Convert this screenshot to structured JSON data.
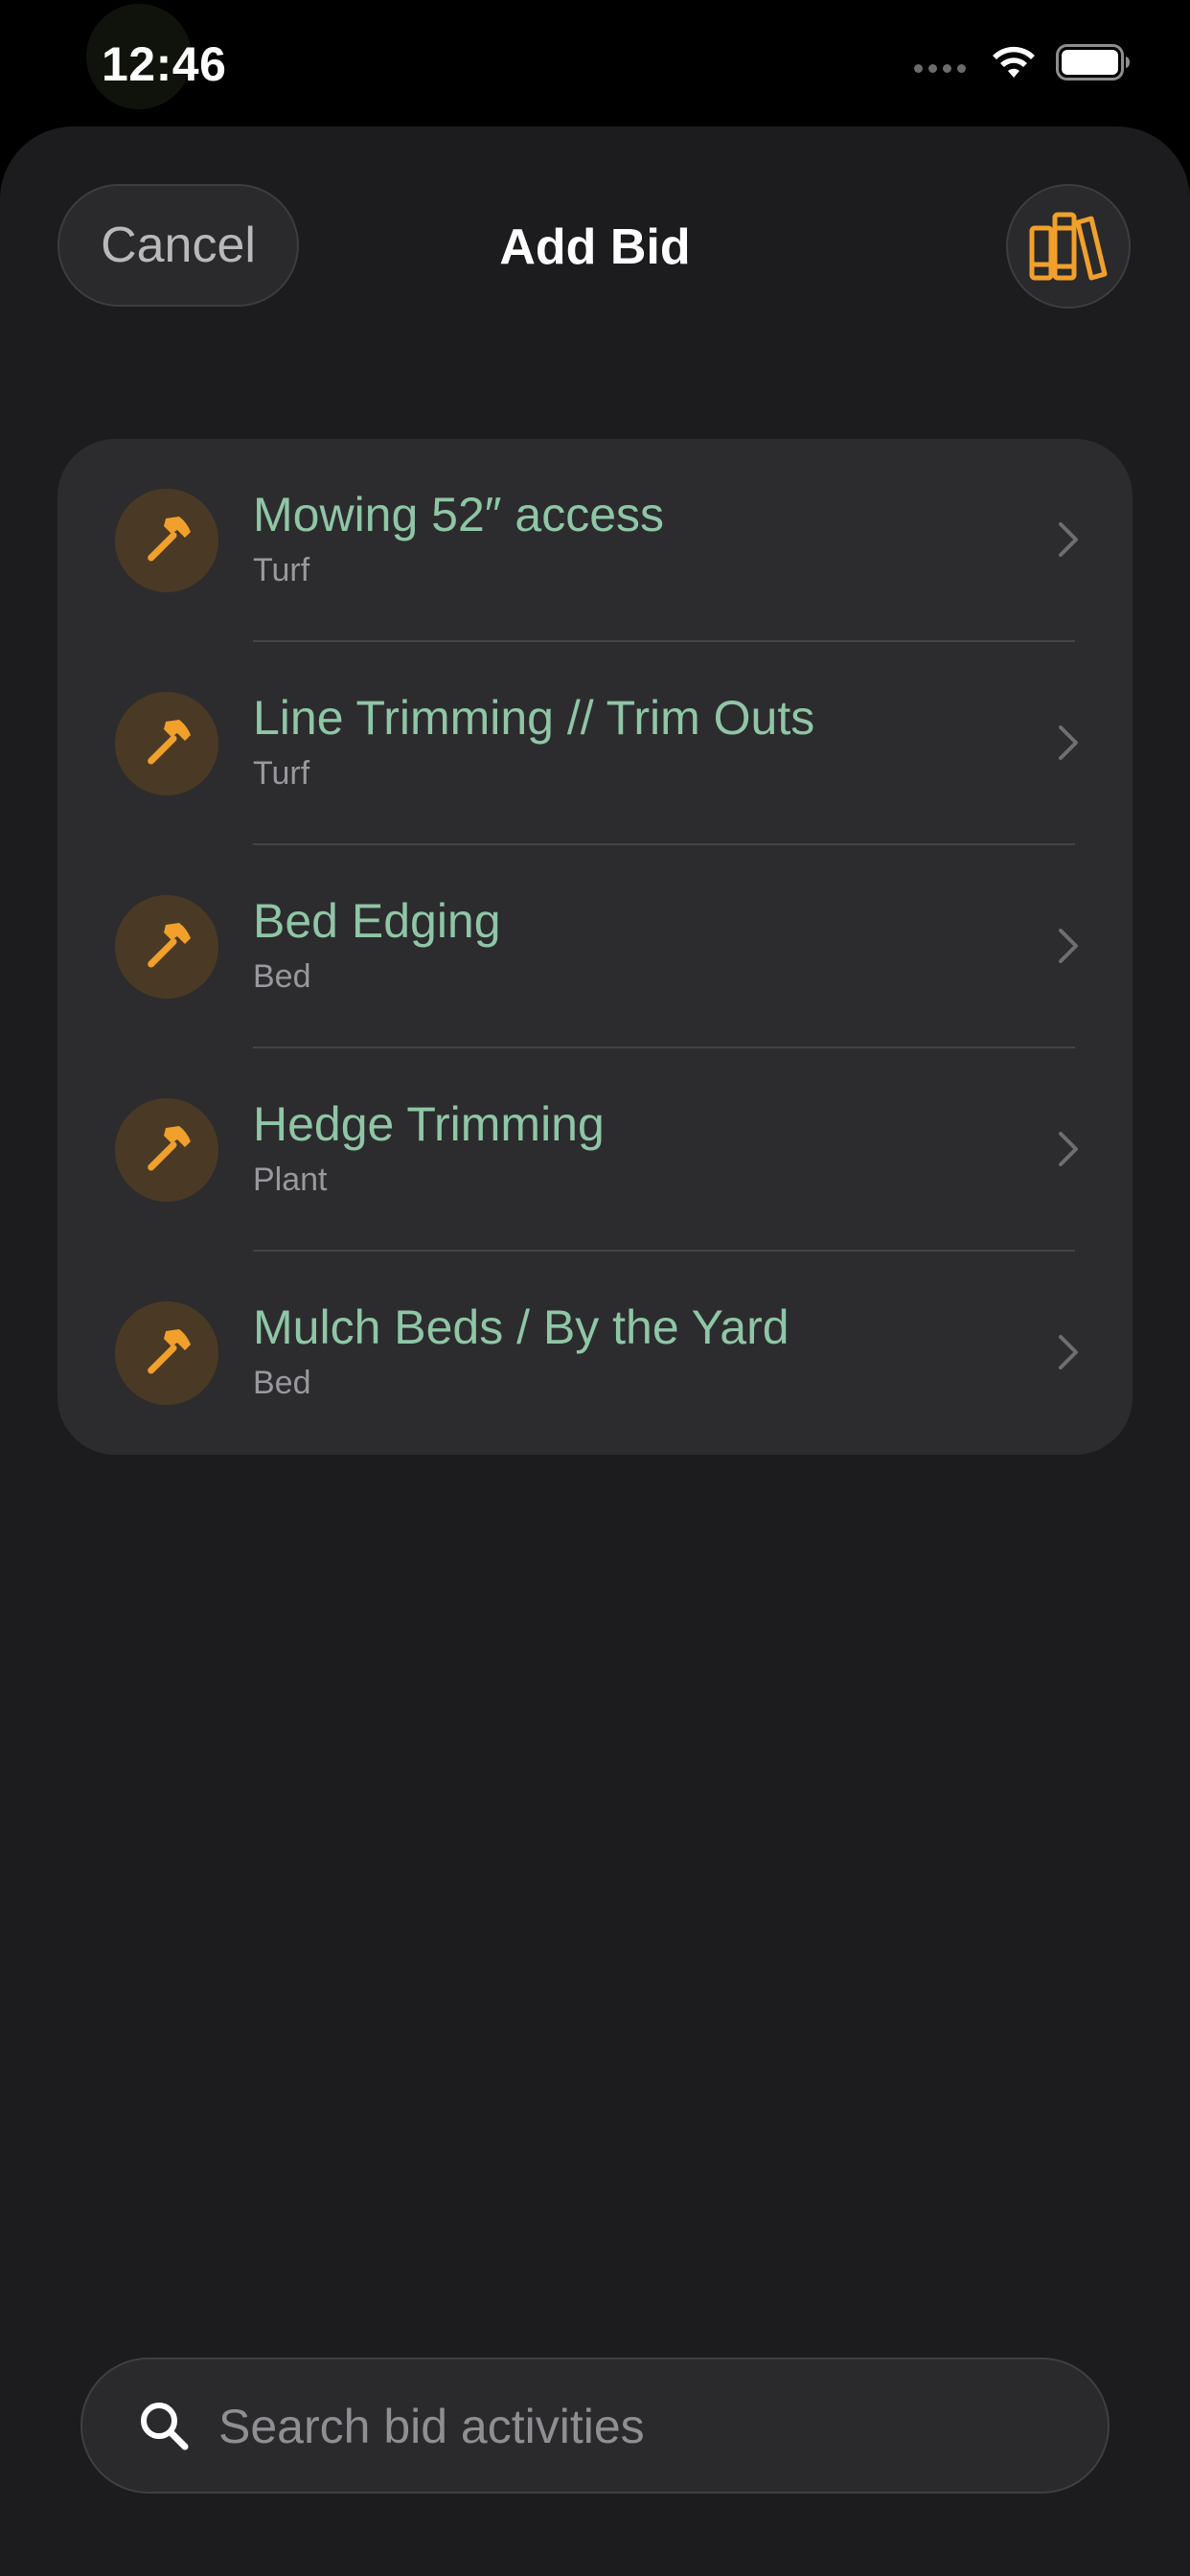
{
  "status_bar": {
    "time": "12:46"
  },
  "header": {
    "cancel_label": "Cancel",
    "title": "Add Bid",
    "library_icon": "books-icon"
  },
  "colors": {
    "accent_orange": "#f0a02b",
    "title_green": "#8fc6a6",
    "sheet_bg": "#1c1c1e",
    "card_bg": "#2c2c2e"
  },
  "activities": [
    {
      "title": "Mowing 52″ access",
      "category": "Turf",
      "icon": "hammer-icon"
    },
    {
      "title": "Line Trimming // Trim Outs",
      "category": "Turf",
      "icon": "hammer-icon"
    },
    {
      "title": "Bed Edging",
      "category": "Bed",
      "icon": "hammer-icon"
    },
    {
      "title": "Hedge Trimming",
      "category": "Plant",
      "icon": "hammer-icon"
    },
    {
      "title": "Mulch Beds / By the Yard",
      "category": "Bed",
      "icon": "hammer-icon"
    }
  ],
  "search": {
    "placeholder": "Search bid activities",
    "value": ""
  }
}
